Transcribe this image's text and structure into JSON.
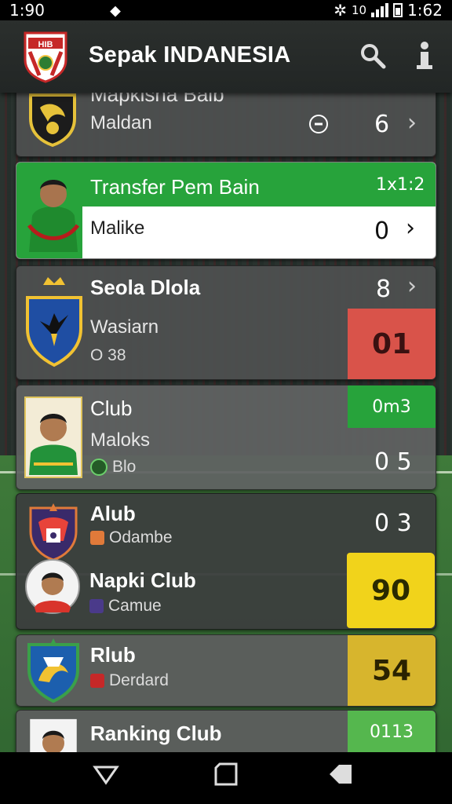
{
  "status": {
    "time": "1:90",
    "right_text": "10",
    "right_time": "1:62"
  },
  "app": {
    "title": "Sepak INDANESIA",
    "logo_text": "HIB"
  },
  "colors": {
    "green": "#27a33b",
    "red": "#d9534a",
    "yellow": "#f1d31b",
    "gold": "#d7b52d",
    "lightgreen": "#55b74e"
  },
  "cards": [
    {
      "title": "Mapkisha Balb",
      "subtitle": "Maldan",
      "value": "6"
    },
    {
      "title": "Transfer Pem Bain",
      "score_top": "1x1:2",
      "subtitle": "Malike",
      "value": "0"
    },
    {
      "title": "Seola Dlola",
      "value_top": "8",
      "subtitle": "Wasiarn",
      "meta": "O 38",
      "score": "01"
    },
    {
      "title": "Club",
      "score_top": "0m3",
      "subtitle": "Maloks",
      "meta": "Blo",
      "score": "0 5"
    },
    {
      "title": "Alub",
      "meta": "Odambe",
      "score": "0 3"
    },
    {
      "title": "Napki Club",
      "meta": "Camue",
      "score": "90"
    },
    {
      "title": "Rlub",
      "meta": "Derdard",
      "score": "54"
    },
    {
      "title": "Ranking Club",
      "score": "0113"
    }
  ]
}
